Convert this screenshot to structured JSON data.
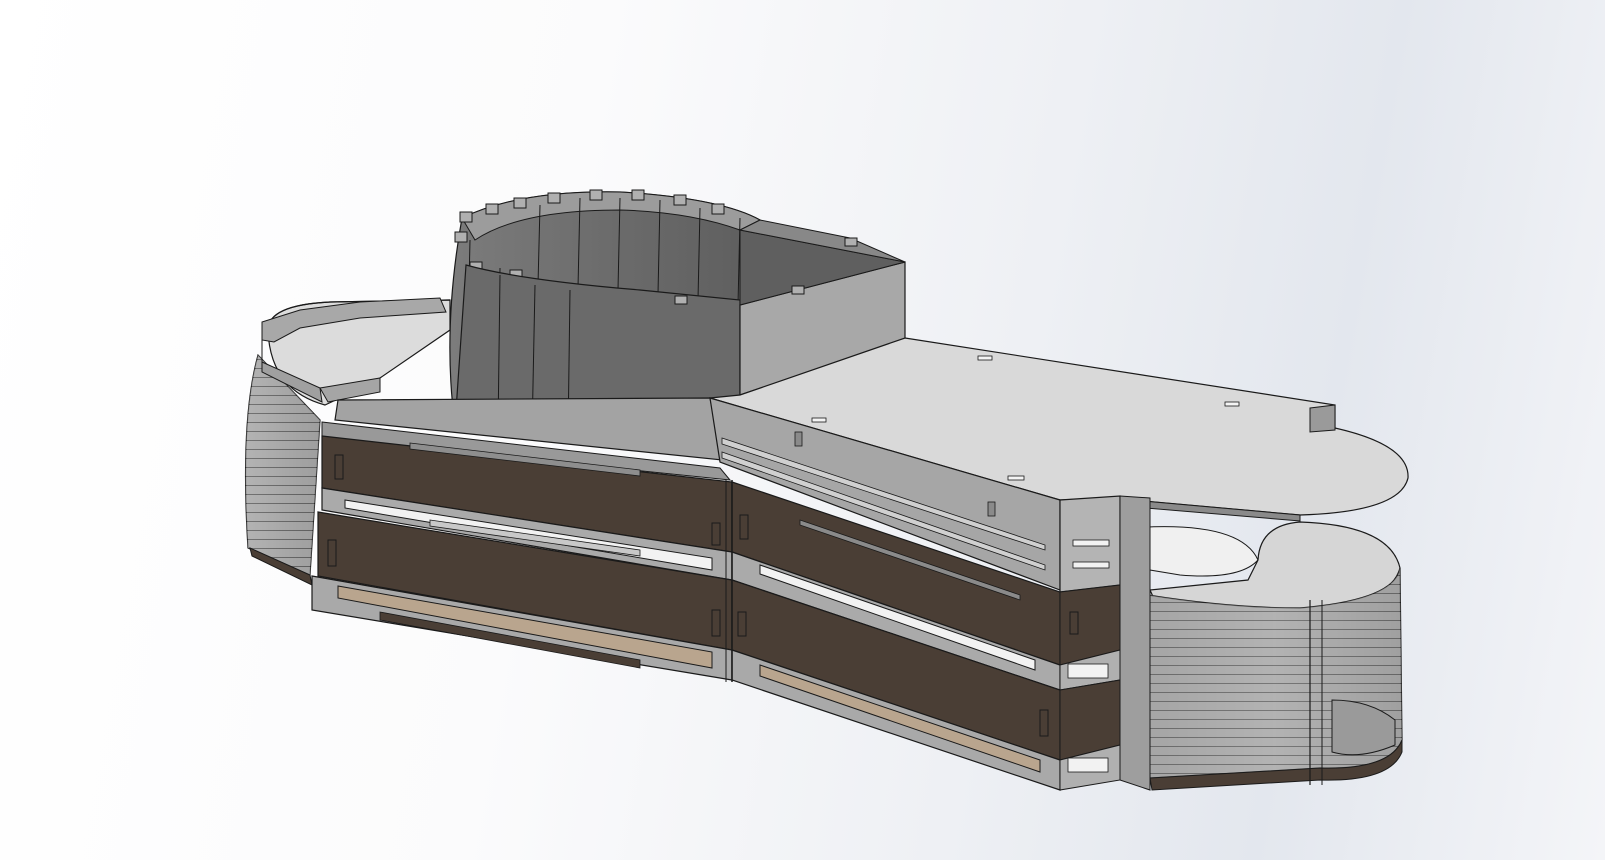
{
  "viewport": {
    "background_gradient": [
      "#ffffff",
      "#fbfbfc",
      "#eef0f4",
      "#e3e7ee"
    ]
  },
  "model": {
    "colors": {
      "panel_light": "#d6d6d6",
      "panel_gray": "#8a8a8a",
      "panel_mid": "#a8a8a8",
      "wall_dark": "#6f6f6f",
      "wood_brown": "#4a3e35",
      "wood_tan": "#b9a58e",
      "edge": "#1a1a1a",
      "slot_white": "#f2f2f2"
    }
  }
}
